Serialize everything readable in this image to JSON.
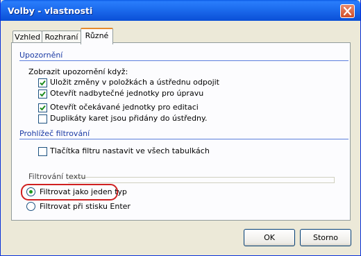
{
  "window": {
    "title": "Volby - vlastnosti"
  },
  "tabs": [
    {
      "label": "Vzhled"
    },
    {
      "label": "Rozhraní"
    },
    {
      "label": "Různé"
    }
  ],
  "upozorneni": {
    "header": "Upozornění",
    "subtitle": "Zobrazit upozornění když:",
    "items": [
      {
        "label": "Uložit změny v položkách a ústřednu odpojit",
        "checked": true
      },
      {
        "label": "Otevřít  nadbytečné jednotky pro úpravu",
        "checked": true
      },
      {
        "label": "Otevřít očekávané jednotky pro editaci",
        "checked": true
      },
      {
        "label": "Duplikáty karet jsou přidány do ústředny.",
        "checked": false
      }
    ]
  },
  "prohlizec": {
    "header": "Prohlížeč filtrování",
    "items": [
      {
        "label": "Tlačítka filtru nastavit ve všech tabulkách",
        "checked": false
      }
    ]
  },
  "filtrovani": {
    "group_label": "Filtrování textu",
    "options": [
      {
        "label": "Filtrovat jako jeden typ",
        "selected": true
      },
      {
        "label": "Filtrovat při stisku Enter",
        "selected": false
      }
    ]
  },
  "buttons": {
    "ok": "OK",
    "cancel": "Storno"
  },
  "colors": {
    "highlight": "#d02020",
    "section_header": "#1a3aa4",
    "title_bar": "#0a5be6"
  }
}
